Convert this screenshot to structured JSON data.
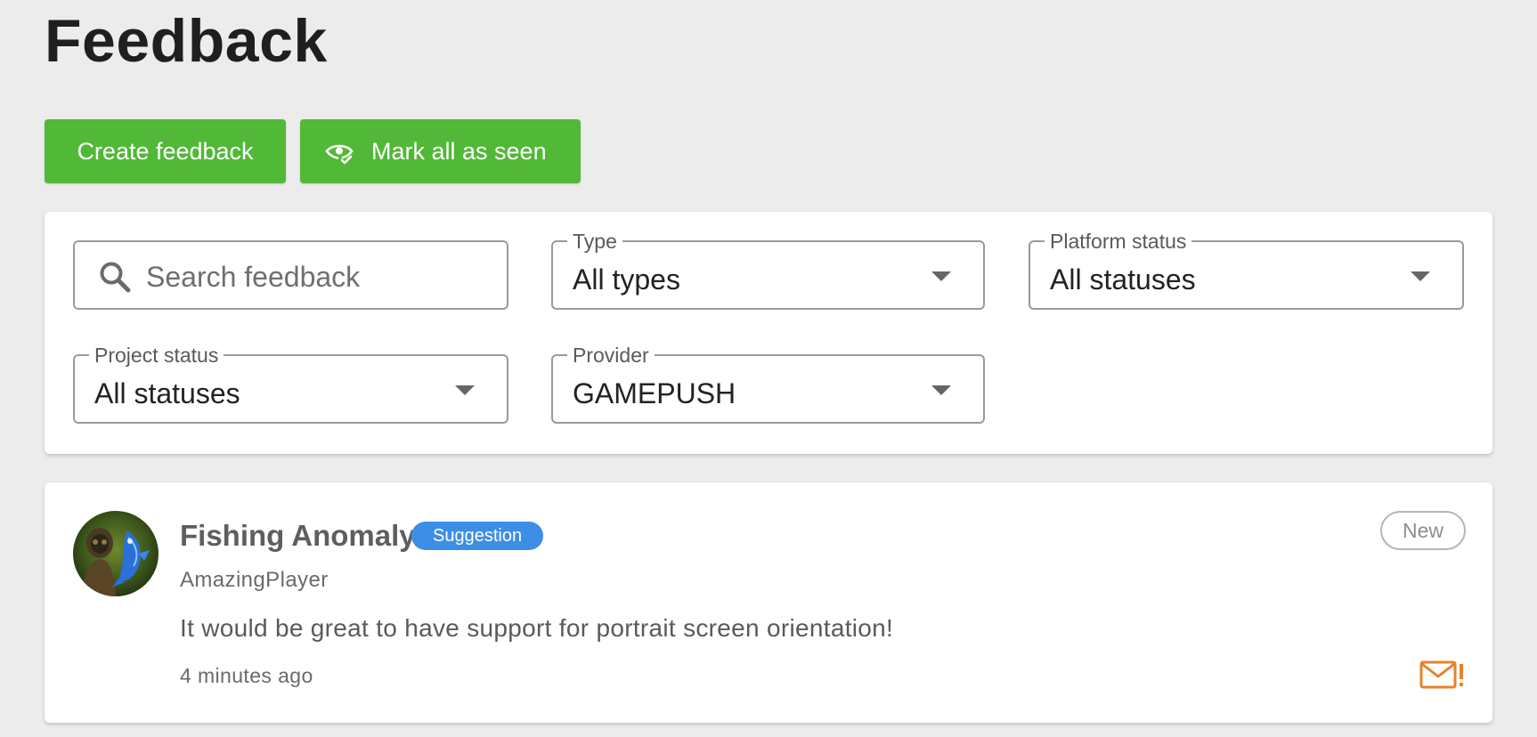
{
  "page": {
    "title": "Feedback"
  },
  "actions": {
    "create_label": "Create feedback",
    "mark_seen_label": "Mark all as seen",
    "accent_color": "#52b837"
  },
  "filters": {
    "search": {
      "placeholder": "Search feedback",
      "value": "",
      "icon": "search-icon"
    },
    "type": {
      "label": "Type",
      "value": "All types"
    },
    "platform_status": {
      "label": "Platform status",
      "value": "All statuses"
    },
    "project_status": {
      "label": "Project status",
      "value": "All statuses"
    },
    "provider": {
      "label": "Provider",
      "value": "GAMEPUSH"
    }
  },
  "feedback_items": [
    {
      "title": "Fishing Anomaly",
      "type_badge": "Suggestion",
      "type_color": "#3d8ee6",
      "status": "New",
      "author": "AmazingPlayer",
      "message": "It would be great to have support for portrait screen orientation!",
      "time": "4 minutes ago",
      "alert_icon": "mail-alert-icon",
      "alert_color": "#e8822a"
    }
  ]
}
